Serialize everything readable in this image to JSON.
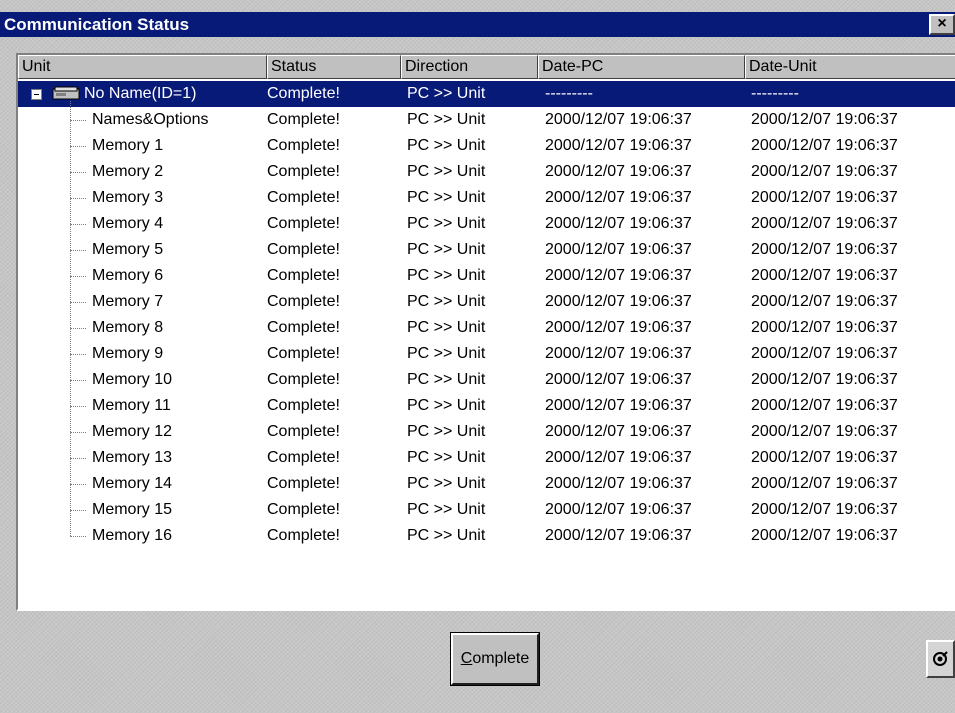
{
  "window": {
    "title": "Communication Status",
    "close_label": "×"
  },
  "columns": [
    "Unit",
    "Status",
    "Direction",
    "Date-PC",
    "Date-Unit"
  ],
  "rows": [
    {
      "unit": "No Name(ID=1)",
      "status": "Complete!",
      "direction": "PC >> Unit",
      "date_pc": "---------",
      "date_unit": "---------",
      "selected": true
    },
    {
      "unit": "Names&Options",
      "status": "Complete!",
      "direction": "PC >> Unit",
      "date_pc": "2000/12/07 19:06:37",
      "date_unit": "2000/12/07 19:06:37"
    },
    {
      "unit": "Memory 1",
      "status": "Complete!",
      "direction": "PC >> Unit",
      "date_pc": "2000/12/07 19:06:37",
      "date_unit": "2000/12/07 19:06:37"
    },
    {
      "unit": "Memory 2",
      "status": "Complete!",
      "direction": "PC >> Unit",
      "date_pc": "2000/12/07 19:06:37",
      "date_unit": "2000/12/07 19:06:37"
    },
    {
      "unit": "Memory 3",
      "status": "Complete!",
      "direction": "PC >> Unit",
      "date_pc": "2000/12/07 19:06:37",
      "date_unit": "2000/12/07 19:06:37"
    },
    {
      "unit": "Memory 4",
      "status": "Complete!",
      "direction": "PC >> Unit",
      "date_pc": "2000/12/07 19:06:37",
      "date_unit": "2000/12/07 19:06:37"
    },
    {
      "unit": "Memory 5",
      "status": "Complete!",
      "direction": "PC >> Unit",
      "date_pc": "2000/12/07 19:06:37",
      "date_unit": "2000/12/07 19:06:37"
    },
    {
      "unit": "Memory 6",
      "status": "Complete!",
      "direction": "PC >> Unit",
      "date_pc": "2000/12/07 19:06:37",
      "date_unit": "2000/12/07 19:06:37"
    },
    {
      "unit": "Memory 7",
      "status": "Complete!",
      "direction": "PC >> Unit",
      "date_pc": "2000/12/07 19:06:37",
      "date_unit": "2000/12/07 19:06:37"
    },
    {
      "unit": "Memory 8",
      "status": "Complete!",
      "direction": "PC >> Unit",
      "date_pc": "2000/12/07 19:06:37",
      "date_unit": "2000/12/07 19:06:37"
    },
    {
      "unit": "Memory 9",
      "status": "Complete!",
      "direction": "PC >> Unit",
      "date_pc": "2000/12/07 19:06:37",
      "date_unit": "2000/12/07 19:06:37"
    },
    {
      "unit": "Memory 10",
      "status": "Complete!",
      "direction": "PC >> Unit",
      "date_pc": "2000/12/07 19:06:37",
      "date_unit": "2000/12/07 19:06:37"
    },
    {
      "unit": "Memory 11",
      "status": "Complete!",
      "direction": "PC >> Unit",
      "date_pc": "2000/12/07 19:06:37",
      "date_unit": "2000/12/07 19:06:37"
    },
    {
      "unit": "Memory 12",
      "status": "Complete!",
      "direction": "PC >> Unit",
      "date_pc": "2000/12/07 19:06:37",
      "date_unit": "2000/12/07 19:06:37"
    },
    {
      "unit": "Memory 13",
      "status": "Complete!",
      "direction": "PC >> Unit",
      "date_pc": "2000/12/07 19:06:37",
      "date_unit": "2000/12/07 19:06:37"
    },
    {
      "unit": "Memory 14",
      "status": "Complete!",
      "direction": "PC >> Unit",
      "date_pc": "2000/12/07 19:06:37",
      "date_unit": "2000/12/07 19:06:37"
    },
    {
      "unit": "Memory 15",
      "status": "Complete!",
      "direction": "PC >> Unit",
      "date_pc": "2000/12/07 19:06:37",
      "date_unit": "2000/12/07 19:06:37"
    },
    {
      "unit": "Memory 16",
      "status": "Complete!",
      "direction": "PC >> Unit",
      "date_pc": "2000/12/07 19:06:37",
      "date_unit": "2000/12/07 19:06:37"
    }
  ],
  "buttons": {
    "complete_mnemonic": "C",
    "complete_rest": "omplete",
    "help_icon": "help-icon"
  },
  "colors": {
    "titlebar": "#081a78",
    "selection": "#081a78",
    "face": "#c0c0c0"
  }
}
